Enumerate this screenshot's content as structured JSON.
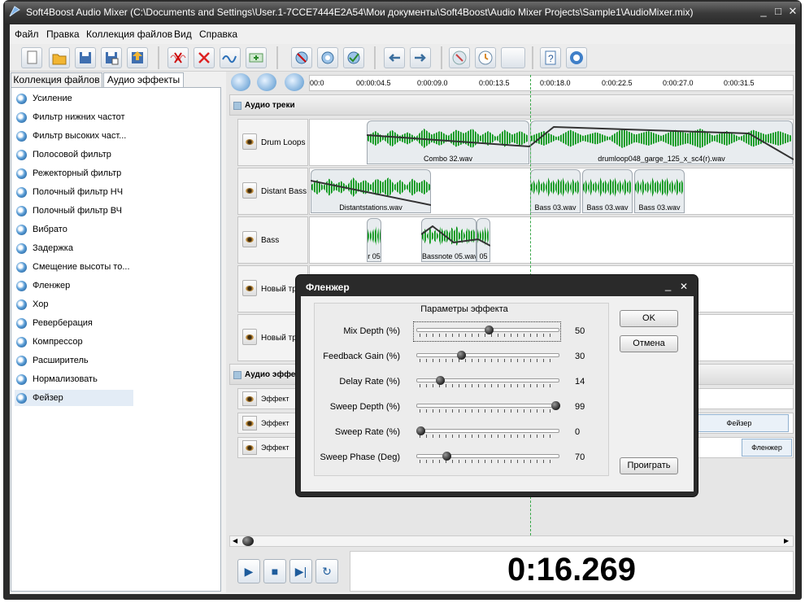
{
  "window": {
    "title": "Soft4Boost Audio Mixer (C:\\Documents and Settings\\User.1-7CCE7444E2A54\\Мои документы\\Soft4Boost\\Audio Mixer Projects\\Sample1\\AudioMixer.mix)",
    "minimize": "_",
    "restore": "□",
    "close": "✕"
  },
  "menu": [
    "Файл",
    "Правка",
    "Коллекция файлов",
    "Вид",
    "Справка"
  ],
  "left_tabs": [
    "Коллекция файлов",
    "Аудио эффекты"
  ],
  "effects": [
    "Усиление",
    "Фильтр нижних частот",
    "Фильтр высоких част...",
    "Полосовой фильтр",
    "Режекторный фильтр",
    "Полочный фильтр НЧ",
    "Полочный фильтр ВЧ",
    "Вибрато",
    "Задержка",
    "Смещение высоты то...",
    "Фленжер",
    "Хор",
    "Реверберация",
    "Компрессор",
    "Расширитель",
    "Нормализовать",
    "Фейзер"
  ],
  "ruler_ticks": [
    "00:0",
    "00:00:04.5",
    "0:00:09.0",
    "0:00:13.5",
    "0:00:18.0",
    "0:00:22.5",
    "0:00:27.0",
    "0:00:31.5"
  ],
  "sections": {
    "audio_tracks": "Аудио треки",
    "audio_effects": "Аудио эффек"
  },
  "tracks": [
    {
      "name": "Drum Loops",
      "clips": [
        "Combo 32.wav",
        "drumloop048_garge_125_x_sc4(r).wav"
      ]
    },
    {
      "name": "Distant Bass",
      "clips": [
        "Distantstations.wav",
        "Bass 03.wav",
        "Bass 03.wav",
        "Bass 03.wav"
      ]
    },
    {
      "name": "Bass",
      "clips": [
        "r 05",
        "Bassnote 05.wav",
        "05"
      ]
    },
    {
      "name": "Новый тре",
      "clips": []
    },
    {
      "name": "Новый тре",
      "clips": []
    }
  ],
  "effect_tracks": [
    {
      "name": "Эффект",
      "block": ""
    },
    {
      "name": "Эффект",
      "block": "Фейзер"
    },
    {
      "name": "Эффект",
      "block": "Фленжер"
    }
  ],
  "time_display": "0:16.269",
  "dialog": {
    "title": "Фленжер",
    "group_title": "Параметры эффекта",
    "ok": "OK",
    "cancel": "Отмена",
    "play": "Проиграть",
    "params": [
      {
        "label": "Mix Depth (%)",
        "value": "50",
        "fraction": 0.5
      },
      {
        "label": "Feedback Gain (%)",
        "value": "30",
        "fraction": 0.3
      },
      {
        "label": "Delay Rate (%)",
        "value": "14",
        "fraction": 0.14
      },
      {
        "label": "Sweep Depth (%)",
        "value": "99",
        "fraction": 0.99
      },
      {
        "label": "Sweep Rate (%)",
        "value": "0",
        "fraction": 0.0
      },
      {
        "label": "Sweep Phase (Deg)",
        "value": "70",
        "fraction": 0.19
      }
    ]
  }
}
